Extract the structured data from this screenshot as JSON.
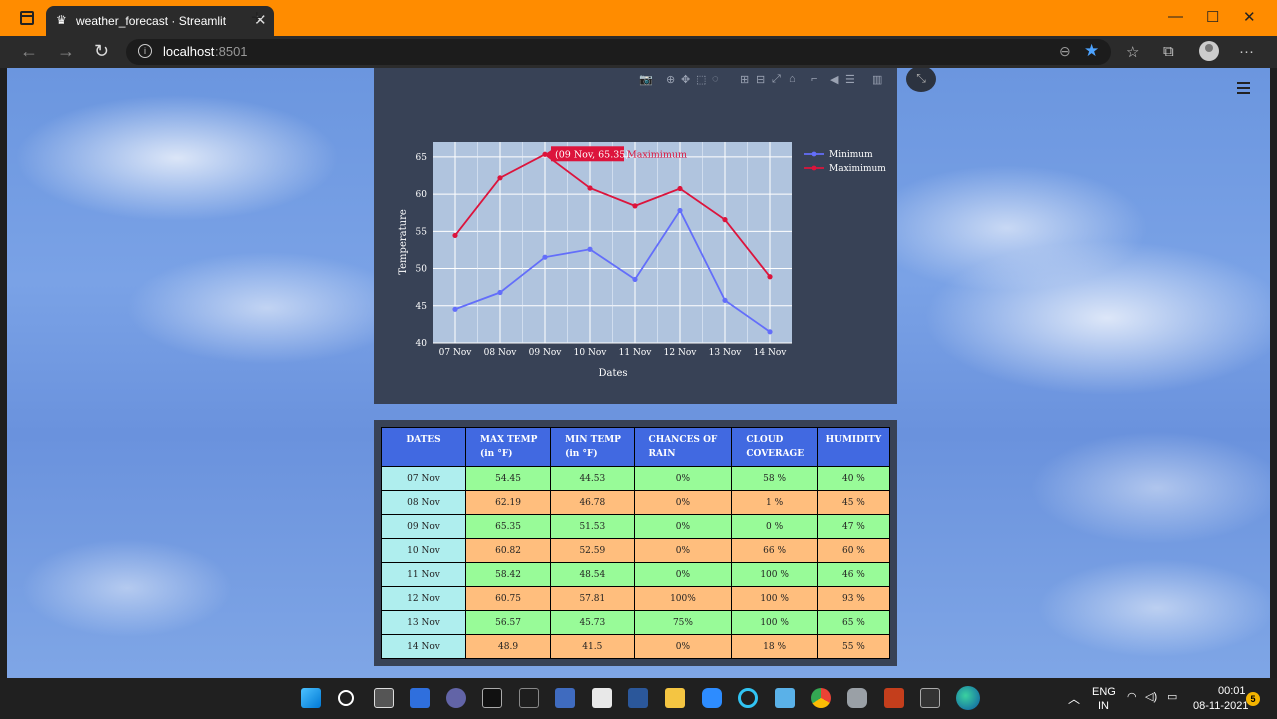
{
  "browser": {
    "tab_title": "weather_forecast · Streamlit",
    "url_host": "localhost",
    "url_port": ":8501"
  },
  "chart_data": {
    "type": "line",
    "categories": [
      "07 Nov",
      "08 Nov",
      "09 Nov",
      "10 Nov",
      "11 Nov",
      "12 Nov",
      "13 Nov",
      "14 Nov"
    ],
    "series": [
      {
        "name": "Minimum",
        "color": "#636efa",
        "values": [
          44.53,
          46.78,
          51.53,
          52.59,
          48.54,
          57.81,
          45.73,
          41.5
        ]
      },
      {
        "name": "Maximimum",
        "color": "#dc143c",
        "values": [
          54.45,
          62.19,
          65.35,
          60.82,
          58.42,
          60.75,
          56.57,
          48.9
        ]
      }
    ],
    "xlabel": "Dates",
    "ylabel": "Temperature",
    "ylim": [
      40,
      67
    ],
    "yticks": [
      40,
      45,
      50,
      55,
      60,
      65
    ],
    "grid": true,
    "legend": "top-right",
    "hover": {
      "label": "(09 Nov, 65.35)",
      "series": "Maximimum",
      "category": "09 Nov"
    }
  },
  "table": {
    "headers": [
      [
        "DATES"
      ],
      [
        "MAX TEMP",
        "(in °F)"
      ],
      [
        "MIN TEMP",
        "(in °F)"
      ],
      [
        "CHANCES OF",
        "RAIN"
      ],
      [
        "CLOUD",
        "COVERAGE"
      ],
      [
        "HUMIDITY"
      ]
    ],
    "rows": [
      {
        "tone": "cool",
        "cells": [
          "07 Nov",
          "54.45",
          "44.53",
          "0%",
          "58 %",
          "40 %"
        ]
      },
      {
        "tone": "warm",
        "cells": [
          "08 Nov",
          "62.19",
          "46.78",
          "0%",
          "1 %",
          "45 %"
        ]
      },
      {
        "tone": "cool",
        "cells": [
          "09 Nov",
          "65.35",
          "51.53",
          "0%",
          "0 %",
          "47 %"
        ]
      },
      {
        "tone": "warm",
        "cells": [
          "10 Nov",
          "60.82",
          "52.59",
          "0%",
          "66 %",
          "60 %"
        ]
      },
      {
        "tone": "cool",
        "cells": [
          "11 Nov",
          "58.42",
          "48.54",
          "0%",
          "100 %",
          "46 %"
        ]
      },
      {
        "tone": "warm",
        "cells": [
          "12 Nov",
          "60.75",
          "57.81",
          "100%",
          "100 %",
          "93 %"
        ]
      },
      {
        "tone": "cool",
        "cells": [
          "13 Nov",
          "56.57",
          "45.73",
          "75%",
          "100 %",
          "65 %"
        ]
      },
      {
        "tone": "warm",
        "cells": [
          "14 Nov",
          "48.9",
          "41.5",
          "0%",
          "18 %",
          "55 %"
        ]
      }
    ],
    "colors": {
      "header": "#4169e1",
      "date": "#afeeee",
      "warm": "#ffbe7d",
      "cool": "#98fb98"
    }
  },
  "taskbar": {
    "lang_top": "ENG",
    "lang_bottom": "IN",
    "time": "00:01",
    "date": "08-11-2021",
    "notifications": "5"
  }
}
